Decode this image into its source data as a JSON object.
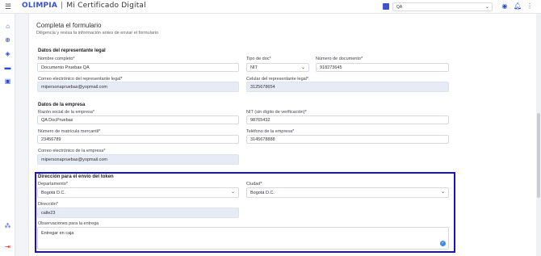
{
  "header": {
    "brand_logo": "OLIMPIA",
    "separator": "|",
    "app_title": "Mi Certificado Digital",
    "org_value": "QA"
  },
  "form": {
    "title": "Completa el formulario",
    "subtitle": "Diligencia y revisa la información antes de enviar el formulario",
    "legal_rep": {
      "section": "Datos del representante legal",
      "name_label": "Nombre completo*",
      "name_value": "Documento Pruebas QA",
      "doctype_label": "Tipo de doc*",
      "doctype_value": "NIT",
      "docnum_label": "Número de documento*",
      "docnum_value": "918273645",
      "email_label": "Correo electrónico del representante legal*",
      "email_value": "mipersonapruebas@yopmail.com",
      "phone_label": "Celular del representante legal*",
      "phone_value": "3125678654"
    },
    "company": {
      "section": "Datos de la empresa",
      "name_label": "Razón social de la empresa*",
      "name_value": "QA DocPruebas",
      "nit_label": "NIT (sin dígito de verificación)*",
      "nit_value": "98765432",
      "reg_label": "Número de matrícula mercantil*",
      "reg_value": "23456789",
      "phone_label": "Teléfono de la empresa*",
      "phone_value": "3145678888",
      "email_label": "Correo electrónico de la empresa*",
      "email_value": "mipersonapruebas@yopmail.com"
    },
    "token": {
      "section": "Dirección para el envío del token",
      "dept_label": "Departamento*",
      "dept_value": "Bogotá D.C.",
      "city_label": "Ciudad*",
      "city_value": "Bogotá D.C.",
      "addr_label": "Dirección*",
      "addr_value": "calle23",
      "obs_label": "Observaciones para la entrega",
      "obs_value": "Entregar en caja"
    }
  },
  "icons": {
    "menu": "menu-icon",
    "store": "store-icon",
    "account": "account-circle-icon",
    "bell": "bell-icon",
    "more": "more-vert-icon",
    "home": "home-icon",
    "add": "add-circle-icon",
    "layers": "layers-icon",
    "folder": "folder-icon",
    "contact": "contact-card-icon",
    "users": "users-icon",
    "logout": "logout-icon"
  },
  "colors": {
    "brand": "#3651c9",
    "accent": "#2f4bc4",
    "highlight_border": "#1b12c7",
    "readonly_fill": "#e7ebf6"
  }
}
